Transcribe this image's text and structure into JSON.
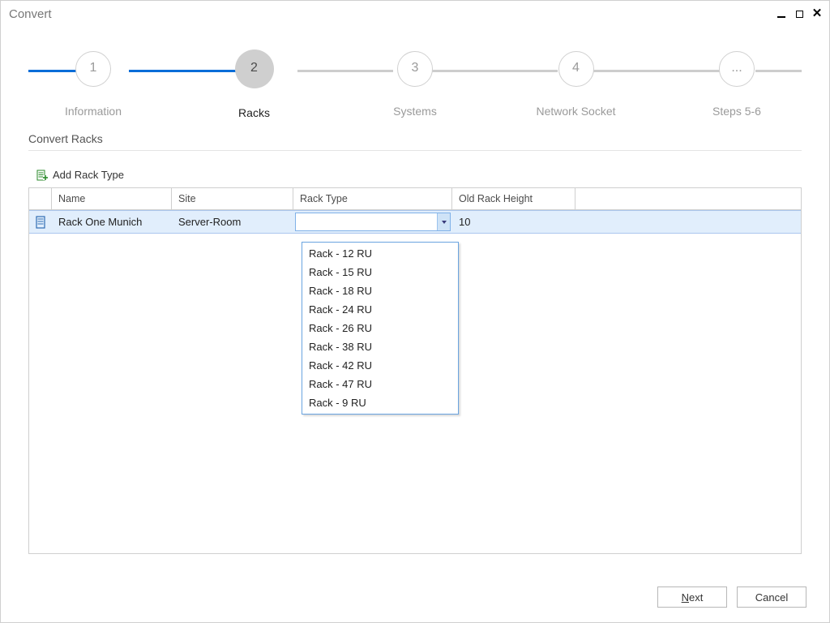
{
  "titlebar": {
    "title": "Convert"
  },
  "stepper": {
    "steps": [
      {
        "num": "1",
        "label": "Information"
      },
      {
        "num": "2",
        "label": "Racks"
      },
      {
        "num": "3",
        "label": "Systems"
      },
      {
        "num": "4",
        "label": "Network Socket"
      },
      {
        "num": "...",
        "label": "Steps 5-6"
      }
    ],
    "current_index": 1
  },
  "section": {
    "title": "Convert Racks",
    "add_label": "Add Rack Type"
  },
  "grid": {
    "columns": [
      "",
      "Name",
      "Site",
      "Rack Type",
      "Old Rack Height",
      ""
    ],
    "row": {
      "name": "Rack One Munich",
      "site": "Server-Room",
      "rack_type": "",
      "old_height": "10"
    },
    "rack_type_options": [
      "Rack - 12 RU",
      "Rack - 15 RU",
      "Rack - 18 RU",
      "Rack - 24 RU",
      "Rack - 26 RU",
      "Rack - 38 RU",
      "Rack - 42 RU",
      "Rack - 47 RU",
      "Rack - 9 RU"
    ]
  },
  "footer": {
    "next_accel": "N",
    "next_rest": "ext",
    "cancel": "Cancel"
  }
}
